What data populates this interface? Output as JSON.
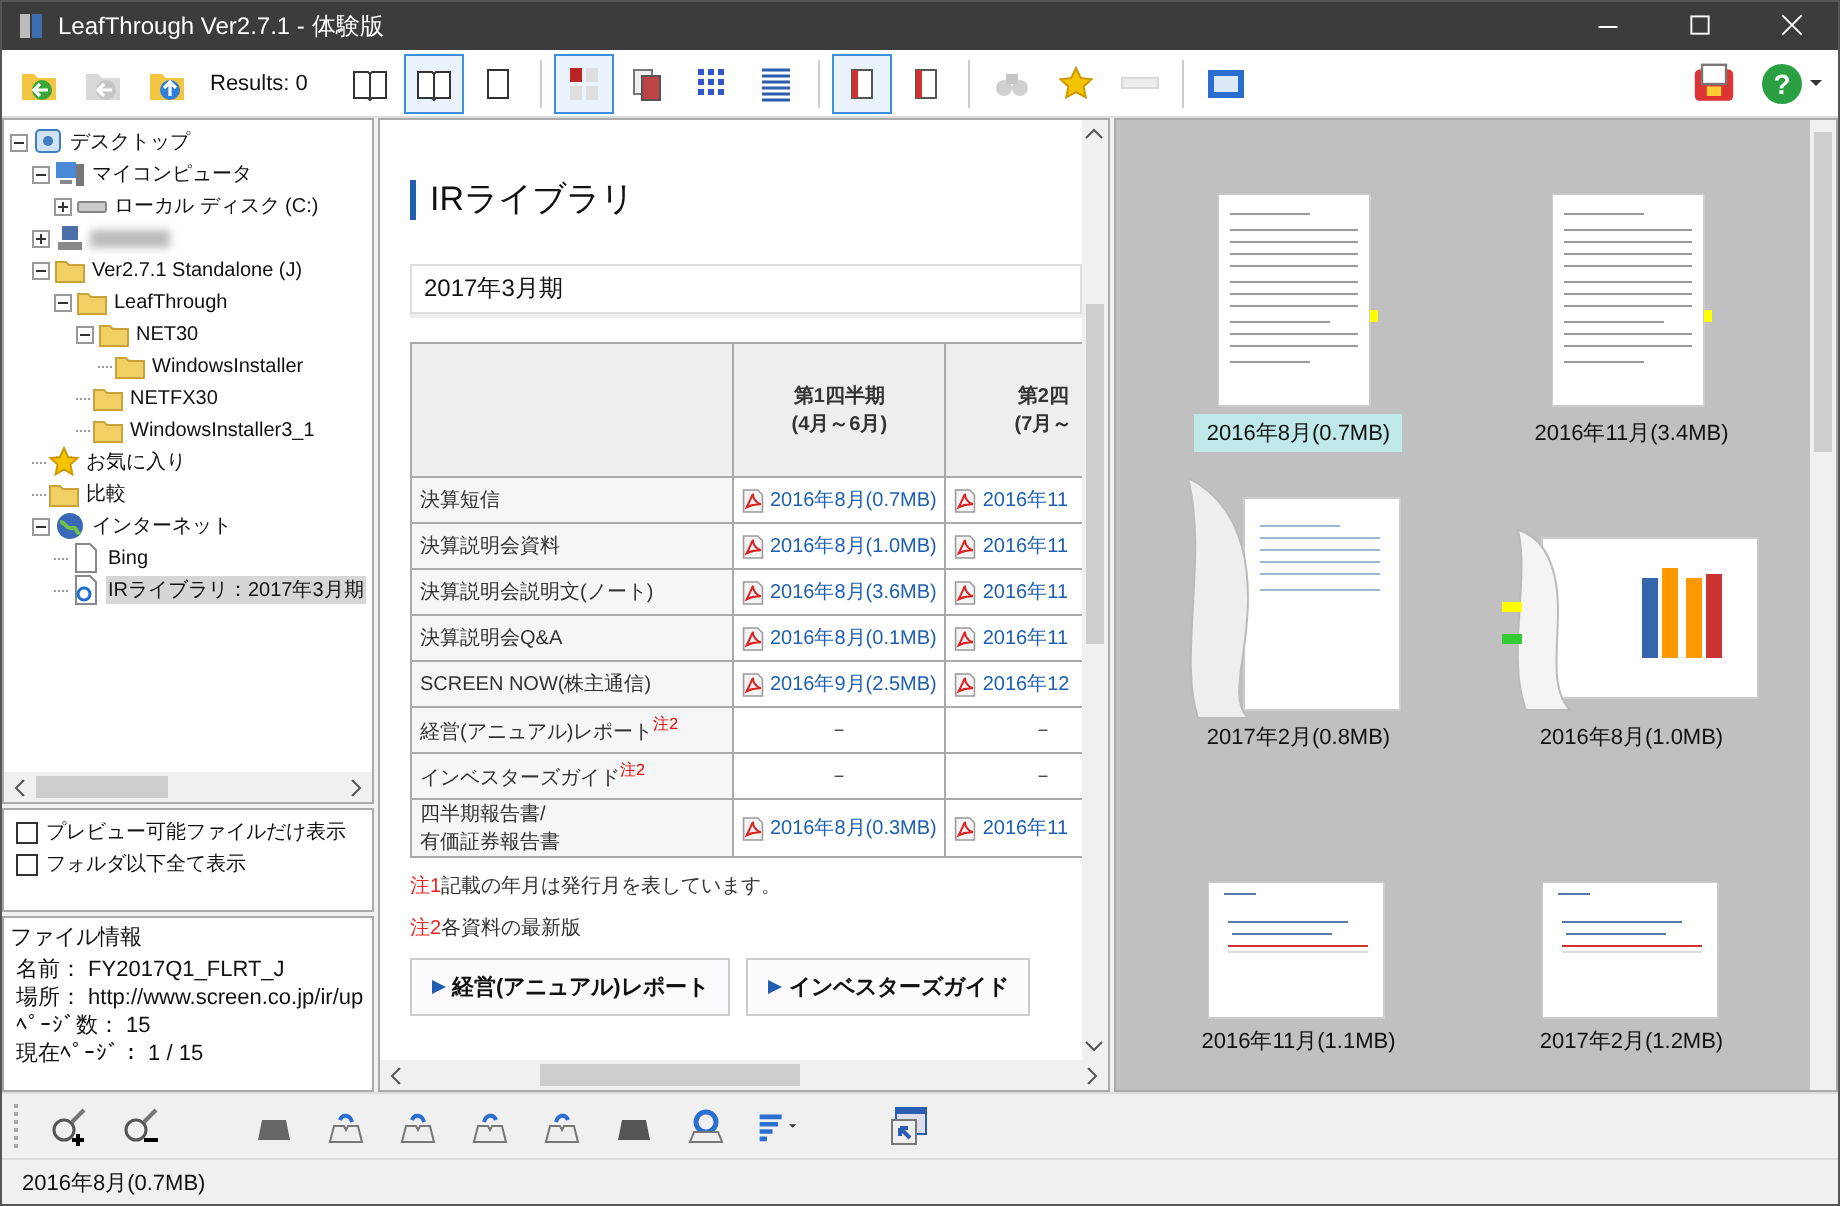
{
  "window": {
    "title": "LeafThrough Ver2.7.1 - 体験版"
  },
  "toolbar": {
    "results": "Results: 0",
    "help_symbol": "?",
    "groups": [
      [
        {
          "kind": "folder-back",
          "selected": false,
          "disabled": false
        },
        {
          "kind": "folder-forward",
          "selected": false,
          "disabled": true
        },
        {
          "kind": "folder-up",
          "selected": false,
          "disabled": false
        }
      ],
      [
        {
          "kind": "book",
          "selected": false,
          "disabled": false
        },
        {
          "kind": "book",
          "selected": true,
          "disabled": false
        },
        {
          "kind": "page",
          "selected": false,
          "disabled": false
        }
      ],
      [
        {
          "kind": "thumbs",
          "selected": true,
          "disabled": false
        },
        {
          "kind": "stack",
          "selected": false,
          "disabled": false
        },
        {
          "kind": "grid",
          "selected": false,
          "disabled": false
        },
        {
          "kind": "list",
          "selected": false,
          "disabled": false
        }
      ],
      [
        {
          "kind": "redbook",
          "selected": true,
          "disabled": false
        },
        {
          "kind": "redbook",
          "selected": false,
          "disabled": false
        }
      ],
      [
        {
          "kind": "binoculars",
          "selected": false,
          "disabled": true
        },
        {
          "kind": "star",
          "selected": false,
          "disabled": false
        },
        {
          "kind": "bar",
          "selected": false,
          "disabled": true
        }
      ],
      [
        {
          "kind": "fullscreen",
          "selected": false,
          "disabled": false
        }
      ]
    ]
  },
  "tree": [
    {
      "label": "デスクトップ",
      "kind": "desktop",
      "expanded": true,
      "selected": false,
      "children": [
        {
          "label": "マイコンピュータ",
          "kind": "computer",
          "expanded": true,
          "selected": false,
          "children": [
            {
              "label": "ローカル ディスク (C:)",
              "kind": "drive",
              "expanded": false,
              "selected": false
            }
          ]
        },
        {
          "blurred": true,
          "kind": "network",
          "expanded": false,
          "selected": false
        },
        {
          "label": "Ver2.7.1 Standalone (J)",
          "kind": "folder",
          "expanded": true,
          "selected": false,
          "children": [
            {
              "label": "LeafThrough",
              "kind": "folder",
              "expanded": true,
              "selected": false,
              "children": [
                {
                  "label": "NET30",
                  "kind": "folder",
                  "expanded": true,
                  "selected": false,
                  "children": [
                    {
                      "label": "WindowsInstaller",
                      "kind": "folder",
                      "selected": false
                    }
                  ]
                },
                {
                  "label": "NETFX30",
                  "kind": "folder",
                  "selected": false
                },
                {
                  "label": "WindowsInstaller3_1",
                  "kind": "folder",
                  "selected": false
                }
              ]
            }
          ]
        },
        {
          "label": "お気に入り",
          "kind": "star",
          "selected": false
        },
        {
          "label": "比較",
          "kind": "compare",
          "selected": false
        },
        {
          "label": "インターネット",
          "kind": "globe",
          "expanded": true,
          "selected": false,
          "children": [
            {
              "label": "Bing",
              "kind": "page",
              "selected": false
            },
            {
              "label": "IRライブラリ：2017年3月期",
              "kind": "webpage",
              "selected": true
            }
          ]
        }
      ]
    }
  ],
  "filters": [
    {
      "label": "プレビュー可能ファイルだけ表示",
      "checked": false
    },
    {
      "label": "フォルダ以下全て表示",
      "checked": false
    }
  ],
  "file_info": {
    "title": "ファイル情報",
    "fields": [
      {
        "label": "名前：",
        "value": "FY2017Q1_FLRT_J"
      },
      {
        "label": "場所：",
        "value": "http://www.screen.co.jp/ir/up"
      },
      {
        "label": "ﾍﾟｰｼﾞ数：",
        "value": "15"
      },
      {
        "label": "現在ﾍﾟｰｼﾞ：",
        "value": "1 / 15"
      }
    ]
  },
  "web_page": {
    "title": "IRライブラリ",
    "section": "2017年3月期",
    "table": {
      "columns": [
        "",
        "第1四半期\n(4月～6月)",
        "第2四\n(7月～"
      ],
      "rows": [
        [
          {
            "kind": "label",
            "text": "決算短信"
          },
          {
            "kind": "pdf",
            "text": "2016年8月(0.7MB)"
          },
          {
            "kind": "pdf",
            "text": "2016年11"
          }
        ],
        [
          {
            "kind": "label",
            "text": "決算説明会資料"
          },
          {
            "kind": "pdf",
            "text": "2016年8月(1.0MB)"
          },
          {
            "kind": "pdf",
            "text": "2016年11"
          }
        ],
        [
          {
            "kind": "label",
            "text": "決算説明会説明文(ノート)"
          },
          {
            "kind": "pdf",
            "text": "2016年8月(3.6MB)"
          },
          {
            "kind": "pdf",
            "text": "2016年11"
          }
        ],
        [
          {
            "kind": "label",
            "text": "決算説明会Q&A"
          },
          {
            "kind": "pdf",
            "text": "2016年8月(0.1MB)"
          },
          {
            "kind": "pdf",
            "text": "2016年11"
          }
        ],
        [
          {
            "kind": "label",
            "text": "SCREEN NOW(株主通信)"
          },
          {
            "kind": "pdf",
            "text": "2016年9月(2.5MB)"
          },
          {
            "kind": "pdf",
            "text": "2016年12"
          }
        ],
        [
          {
            "kind": "label",
            "text": "経営(アニュアル)レポート$^{注2}$"
          },
          {
            "kind": "dash",
            "text": "－"
          },
          {
            "kind": "dash",
            "text": "－"
          }
        ],
        [
          {
            "kind": "label",
            "text": "インベスターズガイド$^{注2}$"
          },
          {
            "kind": "dash",
            "text": "－"
          },
          {
            "kind": "dash",
            "text": "－"
          }
        ],
        [
          {
            "kind": "label",
            "text": "四半期報告書/\n有価証券報告書"
          },
          {
            "kind": "pdf",
            "text": "2016年8月(0.3MB)"
          },
          {
            "kind": "pdf",
            "text": "2016年11"
          }
        ]
      ]
    },
    "notes": [
      {
        "mark": "注1",
        "text": "記載の年月は発行月を表しています。"
      },
      {
        "mark": "注2",
        "text": "各資料の最新版"
      }
    ],
    "banners": [
      "経営(アニュアル)レポート",
      "インベスターズガイド"
    ]
  },
  "thumbnails": [
    {
      "caption": "2016年8月(0.7MB)",
      "kind": "portrait",
      "selected": true
    },
    {
      "caption": "2016年11月(3.4MB)",
      "kind": "portrait",
      "selected": false
    },
    {
      "caption": "2017年2月(0.8MB)",
      "kind": "curled",
      "selected": false
    },
    {
      "caption": "2016年8月(1.0MB)",
      "kind": "chart",
      "selected": false
    },
    {
      "caption": "2016年11月(1.1MB)",
      "kind": "landscape",
      "selected": false
    },
    {
      "caption": "2017年2月(1.2MB)",
      "kind": "landscape",
      "selected": false
    }
  ],
  "status_bar": {
    "text": "2016年8月(0.7MB)"
  }
}
